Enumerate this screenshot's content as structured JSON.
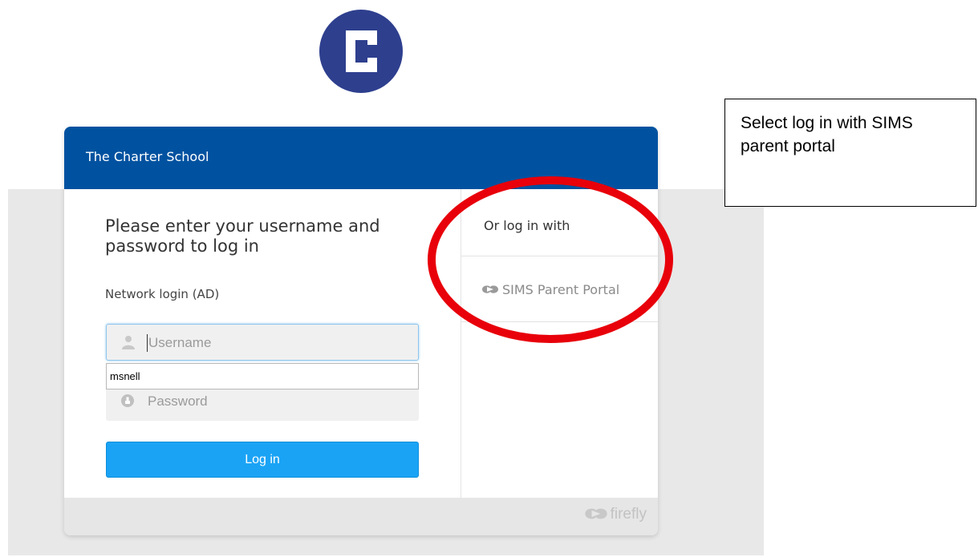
{
  "header": {
    "school_name": "The Charter School"
  },
  "login": {
    "heading": "Please enter your username and password to log in",
    "subheading": "Network login (AD)",
    "username_placeholder": "Username",
    "password_placeholder": "Password",
    "autocomplete_suggestion": "msnell",
    "login_button": "Log in"
  },
  "alternate": {
    "heading": "Or log in with",
    "sims_link": "SIMS Parent Portal"
  },
  "footer": {
    "brand": "firefly"
  },
  "annotation": {
    "note": "Select log in with SIMS parent portal"
  },
  "colors": {
    "header_blue": "#0052a0",
    "button_blue": "#1aa3f5",
    "logo_blue": "#2e3f8e",
    "highlight_red": "#e8000a"
  },
  "icons": {
    "logo": "charter-c-logo",
    "username": "user-icon",
    "password": "lock-icon",
    "sims": "firefly-icon"
  }
}
